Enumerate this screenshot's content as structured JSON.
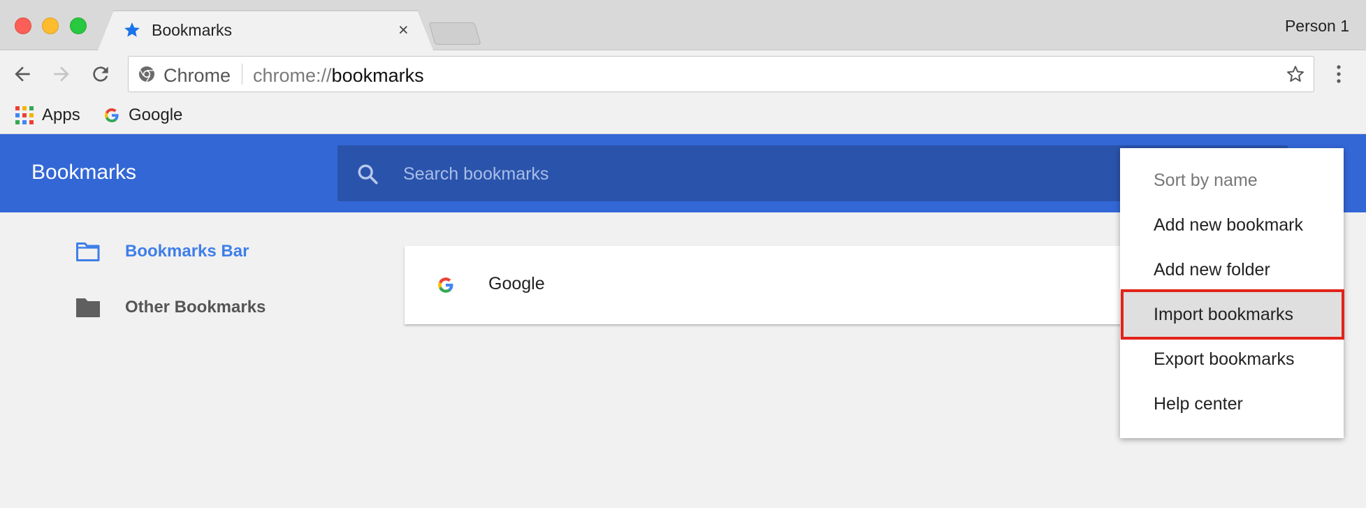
{
  "window": {
    "tab_title": "Bookmarks",
    "tab_close": "×",
    "profile": "Person 1"
  },
  "toolbar": {
    "chrome_label": "Chrome",
    "url_scheme": "chrome://",
    "url_host": "bookmarks"
  },
  "bookmarks_bar": {
    "items": [
      {
        "label": "Apps",
        "icon": "apps-grid-icon"
      },
      {
        "label": "Google",
        "icon": "google-icon"
      }
    ]
  },
  "header": {
    "title": "Bookmarks",
    "search_placeholder": "Search bookmarks"
  },
  "sidebar": {
    "items": [
      {
        "label": "Bookmarks Bar",
        "icon": "folder-outline-icon",
        "selected": true
      },
      {
        "label": "Other Bookmarks",
        "icon": "folder-filled-icon",
        "selected": false
      }
    ]
  },
  "list": {
    "items": [
      {
        "title": "Google",
        "icon": "google-icon"
      }
    ]
  },
  "menu": {
    "items": [
      {
        "label": "Sort by name",
        "disabled": true
      },
      {
        "label": "Add new bookmark"
      },
      {
        "label": "Add new folder"
      },
      {
        "label": "Import bookmarks",
        "highlighted": true
      },
      {
        "label": "Export bookmarks"
      },
      {
        "label": "Help center"
      }
    ]
  },
  "colors": {
    "header_blue": "#3367d6",
    "search_blue": "#2a53ab",
    "accent_blue": "#3f7ee8",
    "highlight_red": "#e2231a"
  }
}
